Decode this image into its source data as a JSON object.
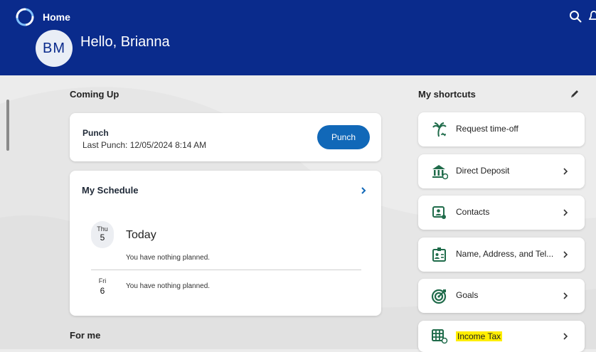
{
  "header": {
    "title": "Home",
    "avatar_initials": "BM",
    "greeting": "Hello, Brianna"
  },
  "coming_up": {
    "title": "Coming Up",
    "punch": {
      "title": "Punch",
      "last_punch": "Last Punch: 12/05/2024 8:14 AM",
      "button_label": "Punch"
    },
    "schedule": {
      "title": "My Schedule",
      "days": [
        {
          "dow": "Thu",
          "num": "5",
          "label": "Today",
          "text": "You have nothing planned."
        },
        {
          "dow": "Fri",
          "num": "6",
          "label": "",
          "text": "You have nothing planned."
        }
      ]
    }
  },
  "for_me": {
    "title": "For me"
  },
  "shortcuts": {
    "title": "My shortcuts",
    "items": [
      {
        "label": "Request time-off",
        "icon": "palm-tree-icon",
        "chevron": false
      },
      {
        "label": "Direct Deposit",
        "icon": "bank-icon",
        "chevron": true
      },
      {
        "label": "Contacts",
        "icon": "contacts-icon",
        "chevron": true
      },
      {
        "label": "Name, Address, and Tel...",
        "icon": "address-card-icon",
        "chevron": true
      },
      {
        "label": "Goals",
        "icon": "target-icon",
        "chevron": true
      },
      {
        "label": "Income Tax",
        "icon": "tax-table-icon",
        "chevron": true,
        "highlighted": true
      }
    ]
  },
  "colors": {
    "header": "#0a2b8c",
    "accent": "#1168b8",
    "icon_green": "#1f6b4a",
    "highlight": "#ffee00"
  }
}
